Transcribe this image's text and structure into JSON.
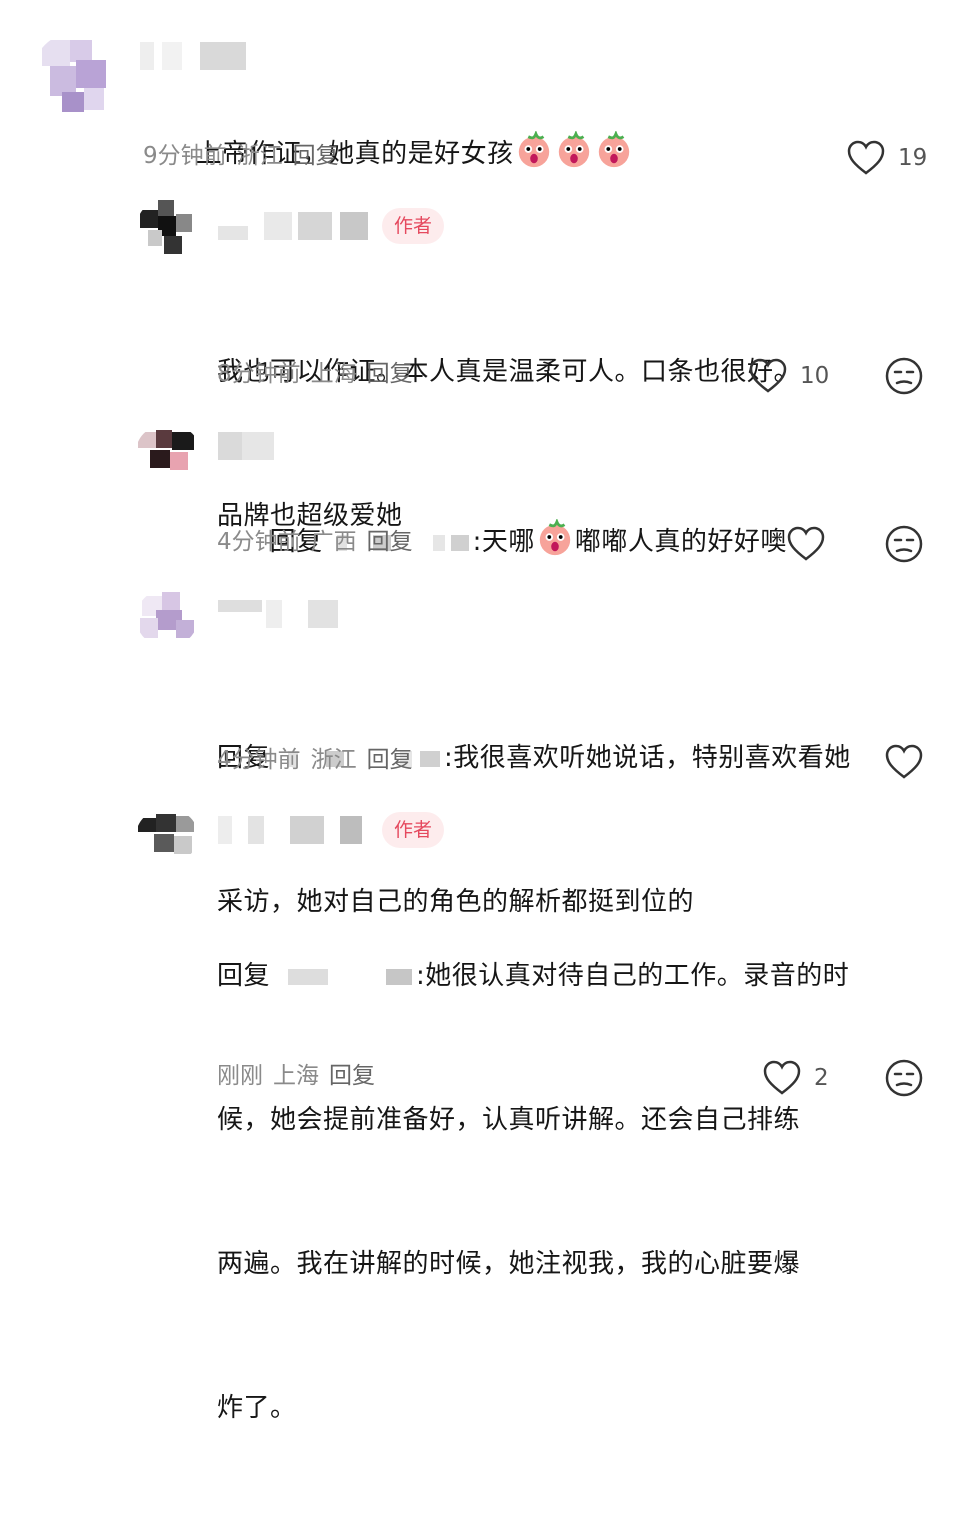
{
  "comments": [
    {
      "text": "上帝作证，她真的是好女孩",
      "emoji_count": 3,
      "time": "9分钟前",
      "location": "浙江",
      "reply_label": "回复",
      "likes": "19"
    },
    {
      "badge": "作者",
      "line1": "我也可以作证。本人真是温柔可人。口条也很好。",
      "line2": "品牌也超级爱她",
      "time": "8分钟前",
      "location": "上海",
      "reply_label": "回复",
      "likes": "10"
    },
    {
      "prefix": "回复",
      "colon": ":",
      "text_a": "天哪",
      "text_b": "嘟嘟人真的好好噢",
      "time": "4分钟前",
      "location": "广西",
      "reply_label": "回复"
    },
    {
      "prefix": "回复",
      "colon": ":",
      "line1": "我很喜欢听她说话，特别喜欢看她",
      "line2": "采访，她对自己的角色的解析都挺到位的",
      "time": "4分钟前",
      "location": "浙江",
      "reply_label": "回复"
    },
    {
      "badge": "作者",
      "prefix": "回复",
      "colon": ":",
      "line1": "她很认真对待自己的工作。录音的时",
      "line2": "候，她会提前准备好，认真听讲解。还会自己排练",
      "line3": "两遍。我在讲解的时候，她注视我，我的心脏要爆",
      "line4": "炸了。",
      "time": "刚刚",
      "location": "上海",
      "reply_label": "回复",
      "likes": "2"
    }
  ],
  "icons": {
    "like": "heart-outline-icon",
    "dislike": "unhappy-face-icon",
    "emoji": "peach-face-emoji-icon"
  },
  "colors": {
    "badge_text": "#e5495e",
    "badge_bg": "#fdeced",
    "meta": "#8a8a8a",
    "text": "#161616"
  }
}
